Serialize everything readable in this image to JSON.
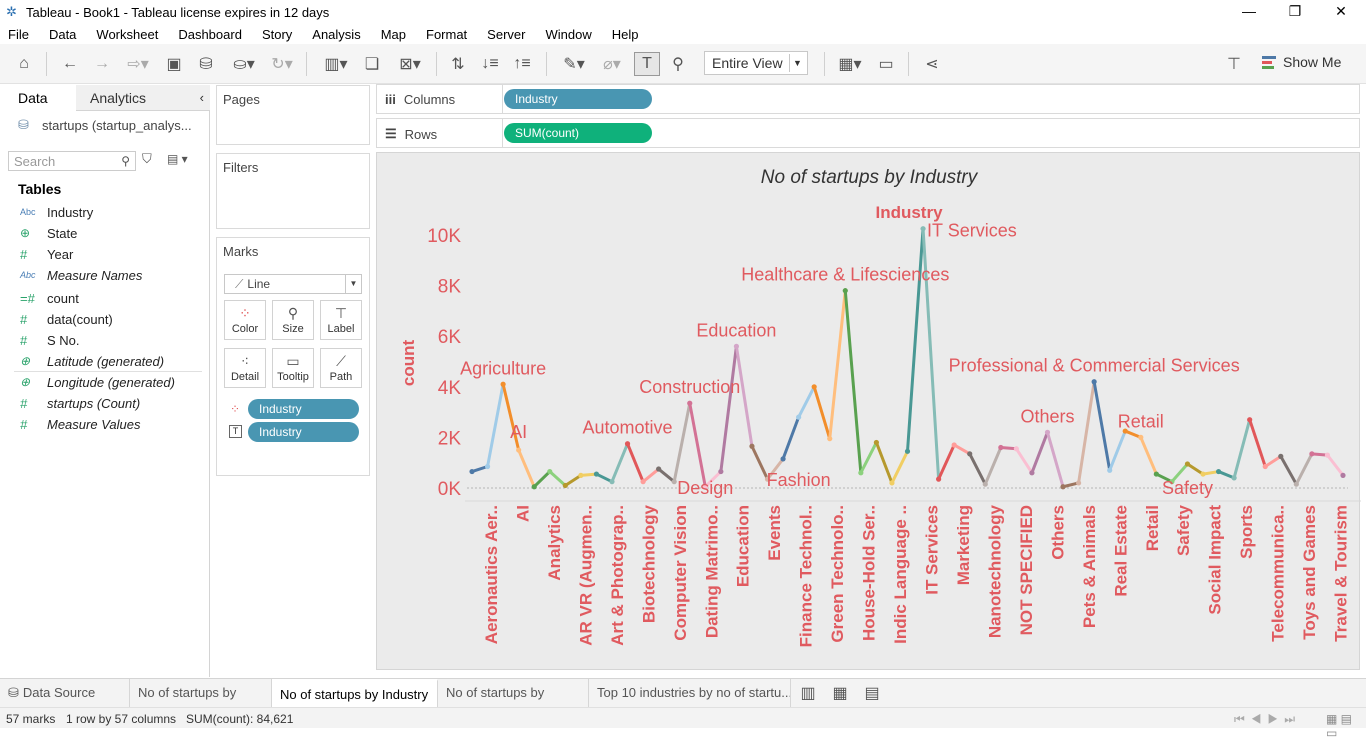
{
  "window": {
    "title": "Tableau - Book1 - Tableau license expires in 12 days"
  },
  "menu": [
    "File",
    "Data",
    "Worksheet",
    "Dashboard",
    "Story",
    "Analysis",
    "Map",
    "Format",
    "Server",
    "Window",
    "Help"
  ],
  "toolbar": {
    "fit_select": "Entire View",
    "show_me_label": "Show Me"
  },
  "data_pane": {
    "tab_data": "Data",
    "tab_analytics": "Analytics",
    "datasource": "startups (startup_analys...",
    "search_placeholder": "Search",
    "tables_heading": "Tables",
    "fields": [
      {
        "name": "Industry",
        "type": "Abc",
        "italic": false
      },
      {
        "name": "State",
        "type": "geo",
        "italic": false
      },
      {
        "name": "Year",
        "type": "#",
        "italic": false
      },
      {
        "name": "Measure Names",
        "type": "Abc",
        "italic": true
      },
      {
        "name": "count",
        "type": "#",
        "italic": false
      },
      {
        "name": "data(count)",
        "type": "#",
        "italic": false
      },
      {
        "name": "S No.",
        "type": "#",
        "italic": false
      },
      {
        "name": "Latitude (generated)",
        "type": "geo",
        "italic": true
      },
      {
        "name": "Longitude (generated)",
        "type": "geo",
        "italic": true
      },
      {
        "name": "startups (Count)",
        "type": "#",
        "italic": true
      },
      {
        "name": "Measure Values",
        "type": "#",
        "italic": true
      }
    ]
  },
  "cards": {
    "pages": "Pages",
    "filters": "Filters",
    "marks": "Marks",
    "mark_type": "Line",
    "buttons": [
      "Color",
      "Size",
      "Label",
      "Detail",
      "Tooltip",
      "Path"
    ],
    "mark_pills": [
      "Industry",
      "Industry"
    ]
  },
  "shelves": {
    "columns_label": "Columns",
    "columns_pill": "Industry",
    "rows_label": "Rows",
    "rows_pill": "SUM(count)"
  },
  "viz": {
    "title": "No of startups by Industry"
  },
  "chart_data": {
    "type": "line",
    "title": "No of startups by Industry",
    "legend_title": "Industry",
    "xlabel": "",
    "ylabel": "count",
    "ylim": [
      -800,
      10500
    ],
    "yticks": [
      0,
      2000,
      4000,
      6000,
      8000,
      10000
    ],
    "ytick_labels": [
      "0K",
      "2K",
      "4K",
      "6K",
      "8K",
      "10K"
    ],
    "xtick_labels": [
      "Aeronautics Aer..",
      "AI",
      "Analytics",
      "AR VR (Augmen..",
      "Art & Photograp..",
      "Biotechnology",
      "Computer Vision",
      "Dating Matrimo..",
      "Education",
      "Events",
      "Finance Technol..",
      "Green Technolo..",
      "House-Hold Ser..",
      "Indic Language ..",
      "IT Services",
      "Marketing",
      "Nanotechnology",
      "NOT SPECIFIED",
      "Others",
      "Pets & Animals",
      "Real Estate",
      "Retail",
      "Safety",
      "Social Impact",
      "Sports",
      "Telecommunica..",
      "Toys and Games",
      "Travel & Tourism"
    ],
    "values": [
      650,
      850,
      4100,
      1500,
      50,
      650,
      100,
      500,
      550,
      250,
      1750,
      250,
      750,
      250,
      3350,
      50,
      650,
      5600,
      1650,
      350,
      1150,
      2800,
      4000,
      1950,
      7800,
      600,
      1800,
      200,
      1450,
      10250,
      350,
      1700,
      1350,
      150,
      1600,
      1550,
      600,
      2200,
      50,
      200,
      4200,
      700,
      2250,
      2000,
      550,
      250,
      950,
      550,
      650,
      400,
      2700,
      850,
      1250,
      150,
      1350,
      1300,
      500
    ],
    "annotations": [
      {
        "label": "Agriculture",
        "index": 2
      },
      {
        "label": "AI",
        "index": 3
      },
      {
        "label": "Automotive",
        "index": 10
      },
      {
        "label": "Construction",
        "index": 14
      },
      {
        "label": "Design",
        "index": 15
      },
      {
        "label": "Education",
        "index": 17
      },
      {
        "label": "Fashion",
        "index": 21
      },
      {
        "label": "Healthcare & Lifesciences",
        "index": 24
      },
      {
        "label": "IT Services",
        "index": 29
      },
      {
        "label": "Professional & Commercial Services",
        "index": 40
      },
      {
        "label": "Others",
        "index": 37
      },
      {
        "label": "Retail",
        "index": 43
      },
      {
        "label": "Safety",
        "index": 46
      }
    ],
    "colors": [
      "#4e79a7",
      "#a0cbe8",
      "#f28e2b",
      "#ffbe7d",
      "#59a14f",
      "#8cd17d",
      "#b6992d",
      "#f1ce63",
      "#499894",
      "#86bcb6",
      "#e15759",
      "#ff9d9a",
      "#79706e",
      "#bab0ac",
      "#d37295",
      "#fabfd2",
      "#b07aa1",
      "#d4a6c8",
      "#9d7660",
      "#d7b5a6"
    ],
    "label_color": "#e05a5f",
    "grid": false
  },
  "sheet_tabs": [
    "Data Source",
    "No of startups by year",
    "No of startups by Industry",
    "No of startups by states",
    "Top 10 industries by no of startu..."
  ],
  "status": {
    "marks": "57 marks",
    "dims": "1 row by 57 columns",
    "sum": "SUM(count): 84,621"
  }
}
